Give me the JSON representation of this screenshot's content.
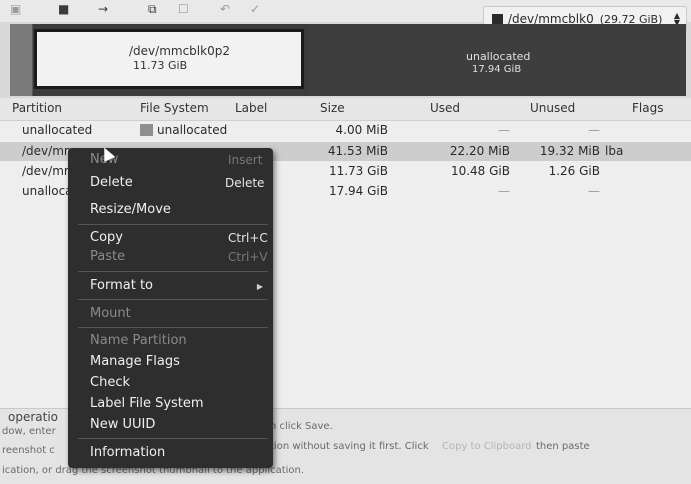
{
  "toolbar": {
    "icons": [
      "new-icon",
      "apply-icon",
      "forward-icon",
      "copy-icon",
      "paste-icon",
      "undo-icon",
      "check-icon"
    ],
    "device": {
      "name": "/dev/mmcblk0",
      "size": "(29.72 GiB)"
    }
  },
  "diskmap": {
    "main": {
      "name": "/dev/mmcblk0p2",
      "size": "11.73 GiB"
    },
    "unallocated": {
      "name": "unallocated",
      "size": "17.94 GiB"
    }
  },
  "table": {
    "headers": {
      "partition": "Partition",
      "filesystem": "File System",
      "label": "Label",
      "size": "Size",
      "used": "Used",
      "unused": "Unused",
      "flags": "Flags"
    },
    "rows": [
      {
        "partition": "unallocated",
        "filesystem": "unallocated",
        "size": "4.00 MiB",
        "used": "—",
        "unused": "—",
        "flags": ""
      },
      {
        "partition": "/dev/mm",
        "filesystem": "",
        "size": "41.53 MiB",
        "used": "22.20 MiB",
        "unused": "19.32 MiB",
        "flags": "lba"
      },
      {
        "partition": "/dev/mm",
        "filesystem": "",
        "size": "11.73 GiB",
        "used": "10.48 GiB",
        "unused": "1.26 GiB",
        "flags": ""
      },
      {
        "partition": "unalloca",
        "filesystem": "",
        "size": "17.94 GiB",
        "used": "—",
        "unused": "—",
        "flags": ""
      }
    ]
  },
  "context_menu": {
    "new": "New",
    "new_accel": "Insert",
    "delete": "Delete",
    "delete_accel": "Delete",
    "resize": "Resize/Move",
    "copy": "Copy",
    "copy_accel": "Ctrl+C",
    "paste": "Paste",
    "paste_accel": "Ctrl+V",
    "format": "Format to",
    "mount": "Mount",
    "name_partition": "Name Partition",
    "manage_flags": "Manage Flags",
    "check": "Check",
    "label_fs": "Label File System",
    "new_uuid": "New UUID",
    "information": "Information"
  },
  "status": {
    "line1": "operatio",
    "line2": "dow, enter",
    "line2_right": "n click Save.",
    "line3": "reenshot c",
    "line3_right": "tion without saving it first. Click",
    "line3_link": "Copy to Clipboard",
    "line3_end": "then paste",
    "line4": "ication, or drag the screenshot thumbnail to the application."
  }
}
